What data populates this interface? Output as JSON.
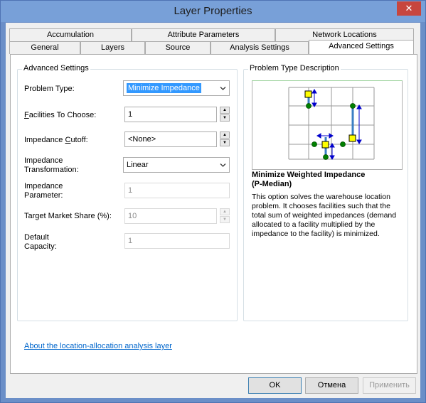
{
  "window": {
    "title": "Layer Properties",
    "close_label": "✕"
  },
  "tabs_top": [
    {
      "label": "Accumulation"
    },
    {
      "label": "Attribute Parameters"
    },
    {
      "label": "Network Locations"
    }
  ],
  "tabs_bottom": [
    {
      "label": "General"
    },
    {
      "label": "Layers"
    },
    {
      "label": "Source"
    },
    {
      "label": "Analysis Settings"
    },
    {
      "label": "Advanced Settings"
    }
  ],
  "advanced": {
    "title": "Advanced Settings",
    "problem_type": {
      "label": "Problem Type:",
      "value": "Minimize Impedance"
    },
    "facilities": {
      "label_prefix": "F",
      "label_rest": "acilities To Choose:",
      "value": "1"
    },
    "impedance_cutoff": {
      "label_prefix": "Impedance ",
      "label_ul": "C",
      "label_rest": "utoff:",
      "value": "<None>"
    },
    "impedance_transformation": {
      "label_line1": "Impedance",
      "label_line2": "Transformation:",
      "value": "Linear"
    },
    "impedance_parameter": {
      "label_line1": "Impedance",
      "label_line2": "Parameter:",
      "value": "1"
    },
    "target_market_share": {
      "label": "Target Market Share (%):",
      "value": "10"
    },
    "default_capacity": {
      "label_line1": "Default",
      "label_line2": "Capacity:",
      "value": "1"
    }
  },
  "description": {
    "title": "Problem Type Description",
    "heading_line1": "Minimize Weighted Impedance",
    "heading_line2": "(P-Median)",
    "body_lines": [
      "This option solves the warehouse location",
      "problem. It chooses facilities such that the",
      "total sum of weighted impedances (demand",
      "allocated to a facility multiplied by the",
      "impedance to the facility) is minimized."
    ]
  },
  "help_link": "About the location-allocation analysis layer",
  "buttons": {
    "ok": "OK",
    "cancel": "Отмена",
    "apply": "Применить"
  },
  "colors": {
    "facility": "#ffff00",
    "demand": "#008000",
    "arrow": "#0000cc",
    "link": "#0066cc"
  }
}
